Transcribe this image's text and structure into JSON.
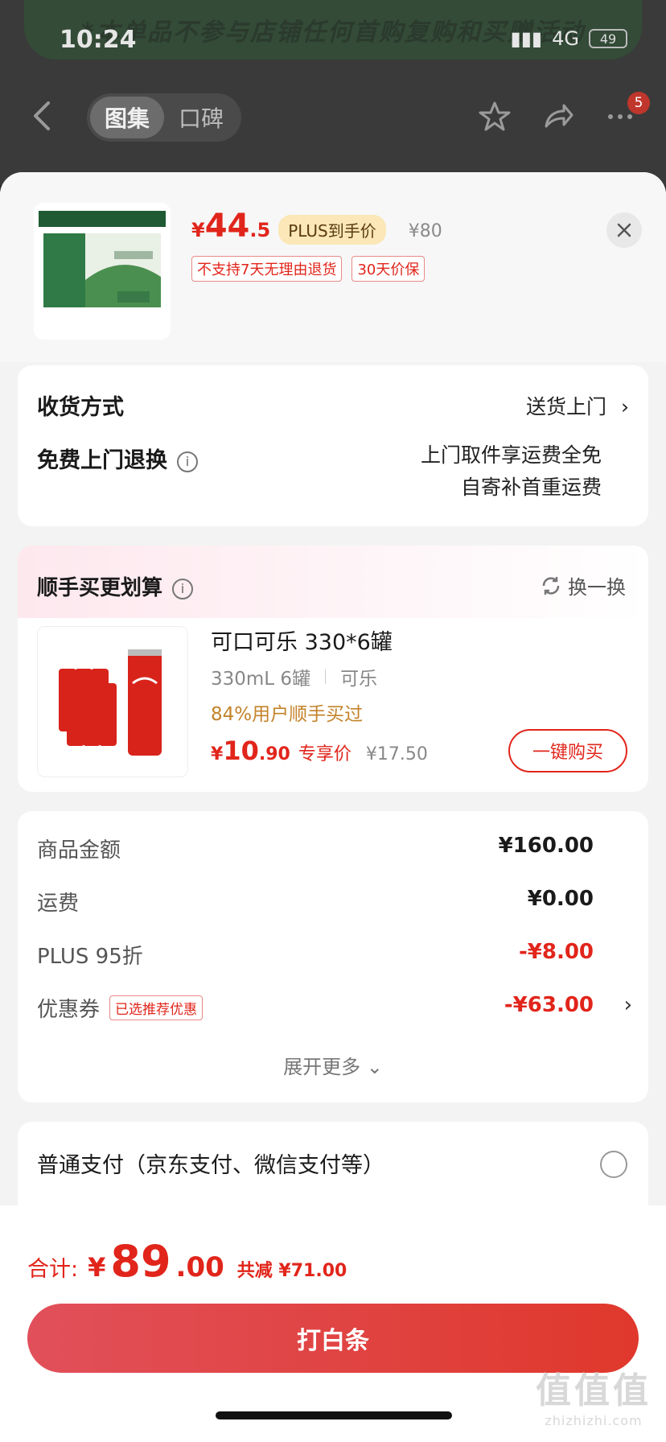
{
  "status_bar": {
    "time": "10:24",
    "network": "4G",
    "battery": "49"
  },
  "banner_text": "*本单品不参与店铺任何首购复购和买赠活动",
  "nav": {
    "tabs": [
      "图集",
      "口碑"
    ],
    "badge": "5"
  },
  "product": {
    "price_yen": "¥",
    "price_int": "44",
    "price_dec": ".5",
    "plus_tag": "PLUS到手价",
    "original_price": "¥80",
    "tags": [
      "不支持7天无理由退货",
      "30天价保"
    ]
  },
  "delivery": {
    "label": "收货方式",
    "value": "送货上门",
    "free_return_label": "免费上门退换",
    "free_return_line1": "上门取件享运费全免",
    "free_return_line2": "自寄补首重运费"
  },
  "addon": {
    "title": "顺手买更划算",
    "switch_label": "换一换",
    "name": "可口可乐 330*6罐",
    "spec1": "330mL 6罐",
    "spec2": "可乐",
    "stat": "84%用户顺手买过",
    "price_yen": "¥",
    "price_int": "10",
    "price_dec": ".90",
    "exclusive": "专享价",
    "orig_price": "¥17.50",
    "buy_label": "一键购买"
  },
  "fees": [
    {
      "label": "商品金额",
      "value": "¥160.00",
      "red": false
    },
    {
      "label": "运费",
      "value": "¥0.00",
      "red": false
    },
    {
      "label": "PLUS 95折",
      "value": "-¥8.00",
      "red": true
    },
    {
      "label": "优惠券",
      "tag": "已选推荐优惠",
      "value": "-¥63.00",
      "red": true
    }
  ],
  "expand_label": "展开更多",
  "payment": {
    "option": "普通支付（京东支付、微信支付等）"
  },
  "total": {
    "label": "合计:",
    "yen": "¥",
    "int": "89",
    "dec": ".00",
    "savings": "共减 ¥71.00",
    "button": "打白条"
  },
  "watermark": {
    "big": "值值值",
    "small": "zhizhizhi.com"
  },
  "colors": {
    "accent": "#e1251b",
    "gold": "#c3832a"
  }
}
